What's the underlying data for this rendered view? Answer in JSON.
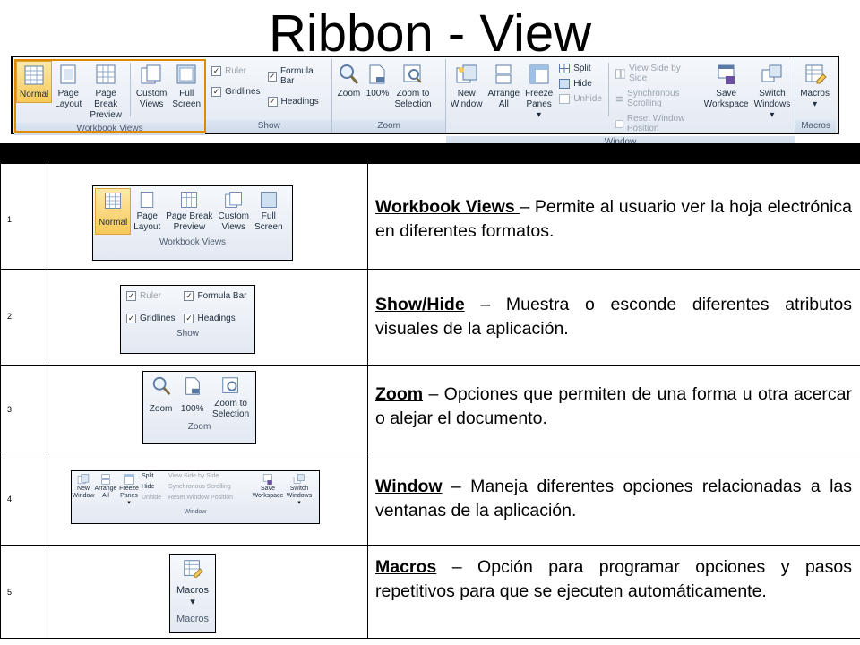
{
  "title": "Ribbon - View",
  "ribbon": {
    "groups": {
      "workbook_views": {
        "label": "Workbook Views",
        "buttons": [
          "Normal",
          "Page\nLayout",
          "Page Break\nPreview",
          "Custom\nViews",
          "Full\nScreen"
        ]
      },
      "show": {
        "label": "Show",
        "items": [
          {
            "label": "Ruler",
            "checked": true,
            "dim": true
          },
          {
            "label": "Formula Bar",
            "checked": true
          },
          {
            "label": "Gridlines",
            "checked": true
          },
          {
            "label": "Headings",
            "checked": true
          }
        ]
      },
      "zoom": {
        "label": "Zoom",
        "buttons": [
          "Zoom",
          "100%",
          "Zoom to\nSelection"
        ]
      },
      "window": {
        "label": "Window",
        "buttons": [
          "New\nWindow",
          "Arrange\nAll",
          "Freeze\nPanes ▾"
        ],
        "small": [
          "Split",
          "Hide",
          "Unhide"
        ],
        "small2": [
          "View Side by Side",
          "Synchronous Scrolling",
          "Reset Window Position"
        ],
        "buttons2": [
          "Save\nWorkspace",
          "Switch\nWindows ▾"
        ]
      },
      "macros": {
        "label": "Macros",
        "buttons": [
          "Macros\n▾"
        ]
      }
    }
  },
  "rows": [
    {
      "num": "1",
      "term": "Workbook Views ",
      "text": " – Permite al usuario ver la hoja electrónica en diferentes formatos."
    },
    {
      "num": "2",
      "term": "Show/Hide",
      "text": " – Muestra o esconde diferentes atributos visuales de la aplicación."
    },
    {
      "num": "3",
      "term": "Zoom",
      "text": " – Opciones que permiten de una forma u otra acercar o alejar el documento."
    },
    {
      "num": "4",
      "term": "Window",
      "text": " – Maneja diferentes opciones relacionadas a las ventanas de la aplicación."
    },
    {
      "num": "5",
      "term": "Macros",
      "text": " – Opción para programar opciones y pasos repetitivos para que se ejecuten automáticamente."
    }
  ],
  "colors": {
    "accent": "#f7c95a",
    "ribbon_bg": "#e3e9f2",
    "ribbon_label": "#4c5a6e"
  },
  "icons": [
    "normal-view-icon",
    "page-layout-icon",
    "page-break-icon",
    "custom-views-icon",
    "full-screen-icon",
    "zoom-icon",
    "zoom-100-icon",
    "zoom-selection-icon",
    "new-window-icon",
    "arrange-all-icon",
    "freeze-panes-icon",
    "split-icon",
    "hide-icon",
    "unhide-icon",
    "save-workspace-icon",
    "switch-windows-icon",
    "macros-icon"
  ]
}
